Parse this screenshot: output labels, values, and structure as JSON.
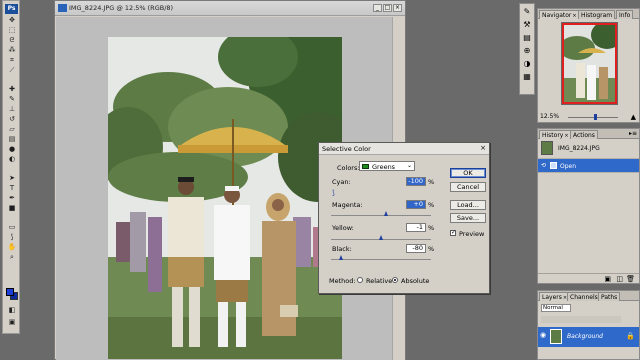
{
  "document": {
    "title": "IMG_8224.JPG @ 12.5% (RGB/8)"
  },
  "dialog": {
    "title": "Selective Color",
    "colors_label": "Colors:",
    "colors_value": "Greens",
    "cyan_label": "Cyan:",
    "cyan_value": "-100",
    "magenta_label": "Magenta:",
    "magenta_value": "+0",
    "yellow_label": "Yellow:",
    "yellow_value": "-1",
    "black_label": "Black:",
    "black_value": "-80",
    "percent": "%",
    "ok_label": "OK",
    "cancel_label": "Cancel",
    "load_label": "Load...",
    "save_label": "Save...",
    "preview_label": "Preview",
    "method_label": "Method:",
    "relative_label": "Relative",
    "absolute_label": "Absolute"
  },
  "navigator_panel": {
    "tabs": [
      "Navigator",
      "Histogram",
      "Info"
    ],
    "zoom": "12.5%"
  },
  "history_panel": {
    "tabs": [
      "History",
      "Actions"
    ],
    "snapshot_name": "IMG_8224.JPG",
    "step_name": "Open"
  },
  "layers_panel": {
    "tabs": [
      "Layers",
      "Channels",
      "Paths"
    ],
    "blend_mode": "Normal",
    "layer_name": "Background"
  },
  "tools": {
    "logo": "Ps"
  }
}
